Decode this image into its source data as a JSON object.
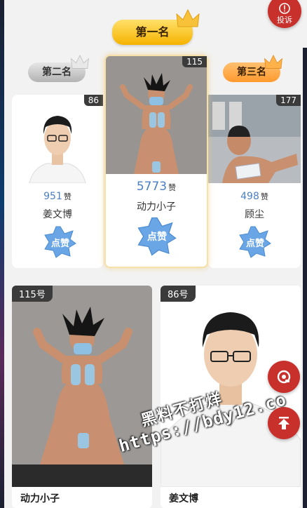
{
  "report": {
    "label": "投诉",
    "icon": "alert-icon"
  },
  "ranks": {
    "first": "第一名",
    "second": "第二名",
    "third": "第三名"
  },
  "podium": [
    {
      "position": "second",
      "number": "86",
      "votes": "951",
      "votes_unit": "赞",
      "name": "姜文博",
      "like_label": "点赞"
    },
    {
      "position": "first",
      "number": "115",
      "votes": "5773",
      "votes_unit": "赞",
      "name": "动力小子",
      "like_label": "点赞"
    },
    {
      "position": "third",
      "number": "177",
      "votes": "498",
      "votes_unit": "赞",
      "name": "顾尘",
      "like_label": "点赞"
    }
  ],
  "entries": [
    {
      "tag": "115号",
      "name": "动力小子"
    },
    {
      "tag": "86号",
      "name": "姜文博"
    }
  ],
  "watermark": {
    "line1": "黑料不打烊",
    "line2": "https://bdy12.co"
  },
  "colors": {
    "accent_red": "#c8302c",
    "vote_blue": "#4b7fc4",
    "gold": "#f5b300"
  }
}
